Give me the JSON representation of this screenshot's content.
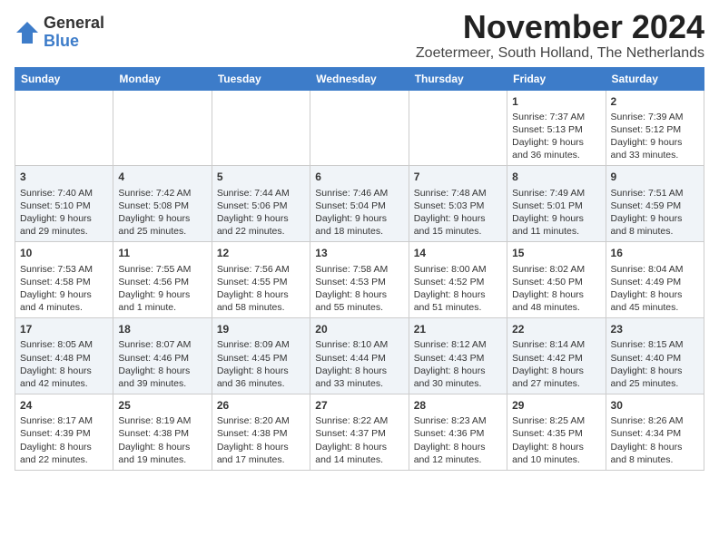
{
  "logo": {
    "general": "General",
    "blue": "Blue"
  },
  "title": "November 2024",
  "location": "Zoetermeer, South Holland, The Netherlands",
  "weekdays": [
    "Sunday",
    "Monday",
    "Tuesday",
    "Wednesday",
    "Thursday",
    "Friday",
    "Saturday"
  ],
  "weeks": [
    [
      {
        "day": "",
        "sunrise": "",
        "sunset": "",
        "daylight": ""
      },
      {
        "day": "",
        "sunrise": "",
        "sunset": "",
        "daylight": ""
      },
      {
        "day": "",
        "sunrise": "",
        "sunset": "",
        "daylight": ""
      },
      {
        "day": "",
        "sunrise": "",
        "sunset": "",
        "daylight": ""
      },
      {
        "day": "",
        "sunrise": "",
        "sunset": "",
        "daylight": ""
      },
      {
        "day": "1",
        "sunrise": "Sunrise: 7:37 AM",
        "sunset": "Sunset: 5:13 PM",
        "daylight": "Daylight: 9 hours and 36 minutes."
      },
      {
        "day": "2",
        "sunrise": "Sunrise: 7:39 AM",
        "sunset": "Sunset: 5:12 PM",
        "daylight": "Daylight: 9 hours and 33 minutes."
      }
    ],
    [
      {
        "day": "3",
        "sunrise": "Sunrise: 7:40 AM",
        "sunset": "Sunset: 5:10 PM",
        "daylight": "Daylight: 9 hours and 29 minutes."
      },
      {
        "day": "4",
        "sunrise": "Sunrise: 7:42 AM",
        "sunset": "Sunset: 5:08 PM",
        "daylight": "Daylight: 9 hours and 25 minutes."
      },
      {
        "day": "5",
        "sunrise": "Sunrise: 7:44 AM",
        "sunset": "Sunset: 5:06 PM",
        "daylight": "Daylight: 9 hours and 22 minutes."
      },
      {
        "day": "6",
        "sunrise": "Sunrise: 7:46 AM",
        "sunset": "Sunset: 5:04 PM",
        "daylight": "Daylight: 9 hours and 18 minutes."
      },
      {
        "day": "7",
        "sunrise": "Sunrise: 7:48 AM",
        "sunset": "Sunset: 5:03 PM",
        "daylight": "Daylight: 9 hours and 15 minutes."
      },
      {
        "day": "8",
        "sunrise": "Sunrise: 7:49 AM",
        "sunset": "Sunset: 5:01 PM",
        "daylight": "Daylight: 9 hours and 11 minutes."
      },
      {
        "day": "9",
        "sunrise": "Sunrise: 7:51 AM",
        "sunset": "Sunset: 4:59 PM",
        "daylight": "Daylight: 9 hours and 8 minutes."
      }
    ],
    [
      {
        "day": "10",
        "sunrise": "Sunrise: 7:53 AM",
        "sunset": "Sunset: 4:58 PM",
        "daylight": "Daylight: 9 hours and 4 minutes."
      },
      {
        "day": "11",
        "sunrise": "Sunrise: 7:55 AM",
        "sunset": "Sunset: 4:56 PM",
        "daylight": "Daylight: 9 hours and 1 minute."
      },
      {
        "day": "12",
        "sunrise": "Sunrise: 7:56 AM",
        "sunset": "Sunset: 4:55 PM",
        "daylight": "Daylight: 8 hours and 58 minutes."
      },
      {
        "day": "13",
        "sunrise": "Sunrise: 7:58 AM",
        "sunset": "Sunset: 4:53 PM",
        "daylight": "Daylight: 8 hours and 55 minutes."
      },
      {
        "day": "14",
        "sunrise": "Sunrise: 8:00 AM",
        "sunset": "Sunset: 4:52 PM",
        "daylight": "Daylight: 8 hours and 51 minutes."
      },
      {
        "day": "15",
        "sunrise": "Sunrise: 8:02 AM",
        "sunset": "Sunset: 4:50 PM",
        "daylight": "Daylight: 8 hours and 48 minutes."
      },
      {
        "day": "16",
        "sunrise": "Sunrise: 8:04 AM",
        "sunset": "Sunset: 4:49 PM",
        "daylight": "Daylight: 8 hours and 45 minutes."
      }
    ],
    [
      {
        "day": "17",
        "sunrise": "Sunrise: 8:05 AM",
        "sunset": "Sunset: 4:48 PM",
        "daylight": "Daylight: 8 hours and 42 minutes."
      },
      {
        "day": "18",
        "sunrise": "Sunrise: 8:07 AM",
        "sunset": "Sunset: 4:46 PM",
        "daylight": "Daylight: 8 hours and 39 minutes."
      },
      {
        "day": "19",
        "sunrise": "Sunrise: 8:09 AM",
        "sunset": "Sunset: 4:45 PM",
        "daylight": "Daylight: 8 hours and 36 minutes."
      },
      {
        "day": "20",
        "sunrise": "Sunrise: 8:10 AM",
        "sunset": "Sunset: 4:44 PM",
        "daylight": "Daylight: 8 hours and 33 minutes."
      },
      {
        "day": "21",
        "sunrise": "Sunrise: 8:12 AM",
        "sunset": "Sunset: 4:43 PM",
        "daylight": "Daylight: 8 hours and 30 minutes."
      },
      {
        "day": "22",
        "sunrise": "Sunrise: 8:14 AM",
        "sunset": "Sunset: 4:42 PM",
        "daylight": "Daylight: 8 hours and 27 minutes."
      },
      {
        "day": "23",
        "sunrise": "Sunrise: 8:15 AM",
        "sunset": "Sunset: 4:40 PM",
        "daylight": "Daylight: 8 hours and 25 minutes."
      }
    ],
    [
      {
        "day": "24",
        "sunrise": "Sunrise: 8:17 AM",
        "sunset": "Sunset: 4:39 PM",
        "daylight": "Daylight: 8 hours and 22 minutes."
      },
      {
        "day": "25",
        "sunrise": "Sunrise: 8:19 AM",
        "sunset": "Sunset: 4:38 PM",
        "daylight": "Daylight: 8 hours and 19 minutes."
      },
      {
        "day": "26",
        "sunrise": "Sunrise: 8:20 AM",
        "sunset": "Sunset: 4:38 PM",
        "daylight": "Daylight: 8 hours and 17 minutes."
      },
      {
        "day": "27",
        "sunrise": "Sunrise: 8:22 AM",
        "sunset": "Sunset: 4:37 PM",
        "daylight": "Daylight: 8 hours and 14 minutes."
      },
      {
        "day": "28",
        "sunrise": "Sunrise: 8:23 AM",
        "sunset": "Sunset: 4:36 PM",
        "daylight": "Daylight: 8 hours and 12 minutes."
      },
      {
        "day": "29",
        "sunrise": "Sunrise: 8:25 AM",
        "sunset": "Sunset: 4:35 PM",
        "daylight": "Daylight: 8 hours and 10 minutes."
      },
      {
        "day": "30",
        "sunrise": "Sunrise: 8:26 AM",
        "sunset": "Sunset: 4:34 PM",
        "daylight": "Daylight: 8 hours and 8 minutes."
      }
    ]
  ]
}
